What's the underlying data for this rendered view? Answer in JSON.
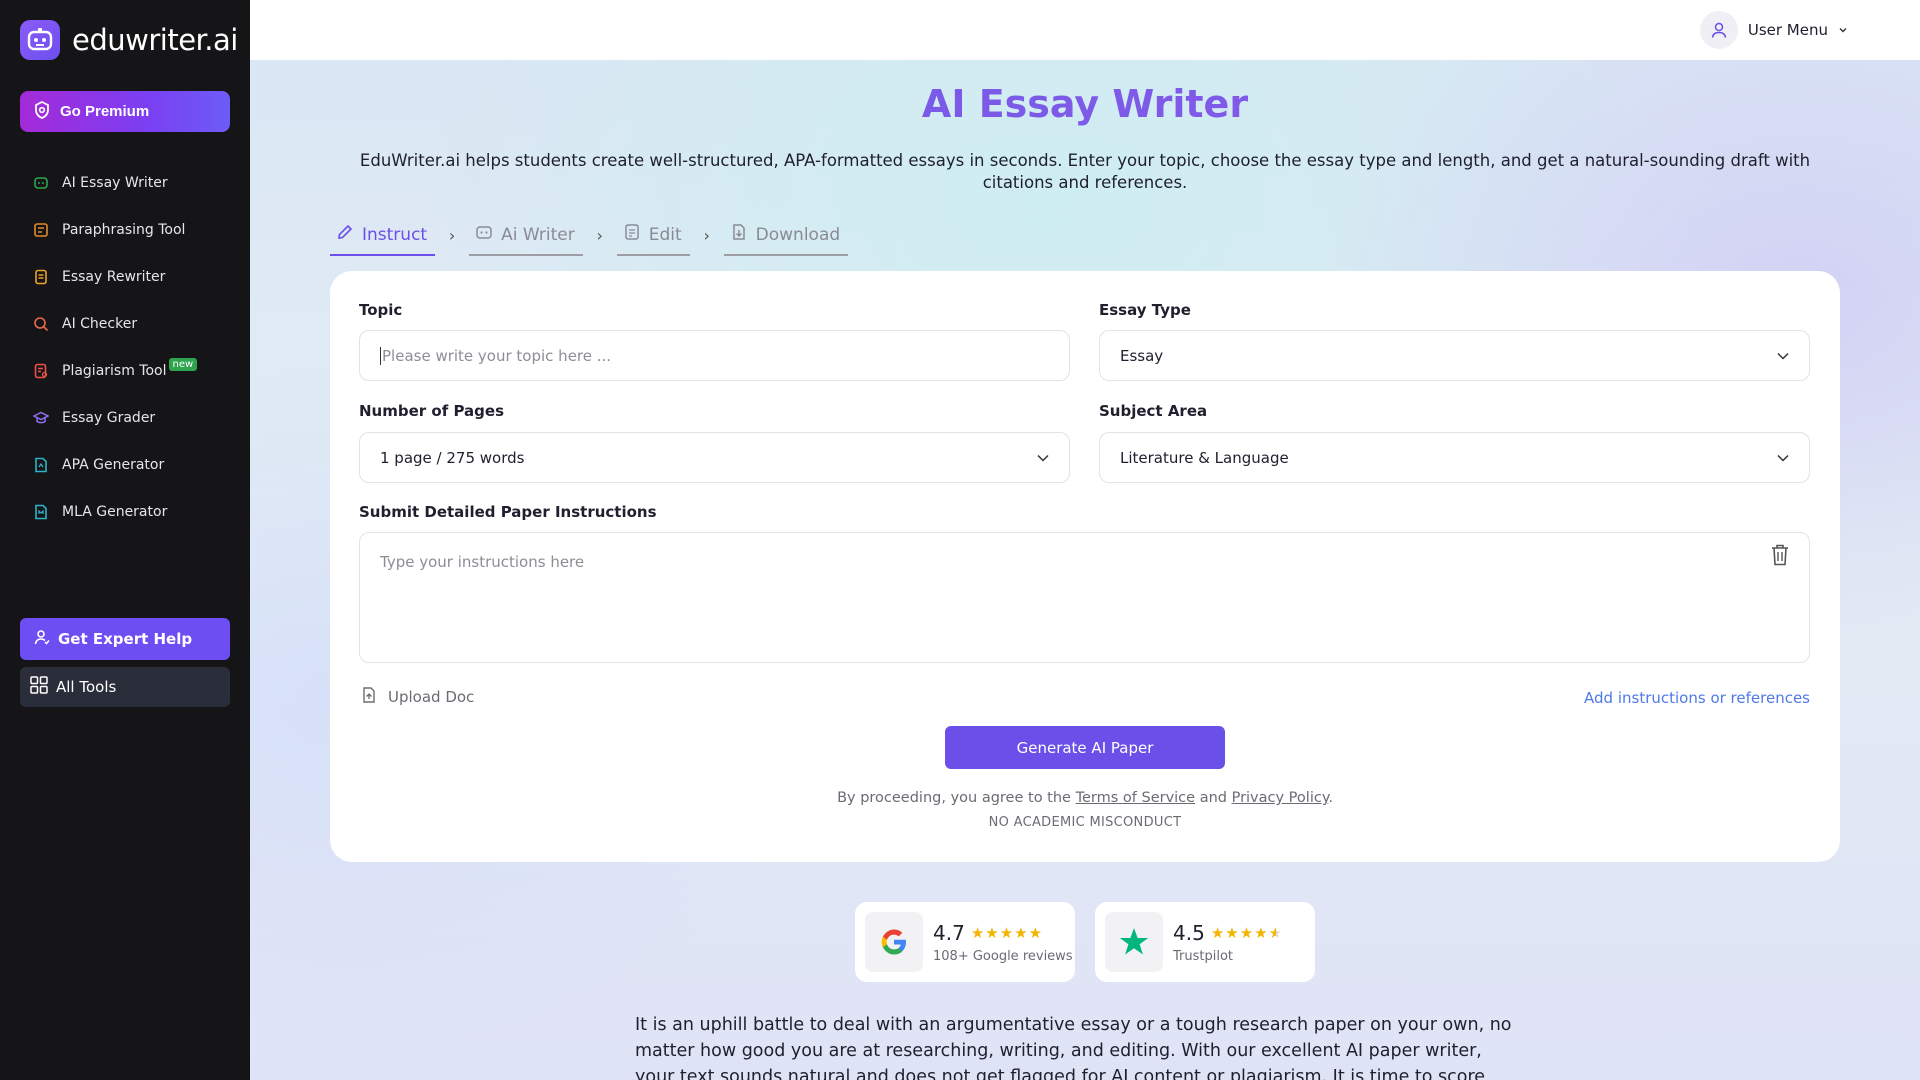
{
  "brand": {
    "name": "eduwriter.ai"
  },
  "sidebar": {
    "premium_label": "Go Premium",
    "items": [
      {
        "label": "AI Essay Writer",
        "icon": "robot-icon",
        "color": "#2ea44f"
      },
      {
        "label": "Paraphrasing Tool",
        "icon": "paraphrase-icon",
        "color": "#e48a2a"
      },
      {
        "label": "Essay Rewriter",
        "icon": "rewrite-icon",
        "color": "#e8a22a"
      },
      {
        "label": "AI Checker",
        "icon": "search-icon",
        "color": "#e86a4a"
      },
      {
        "label": "Plagiarism Tool",
        "icon": "plagiarism-icon",
        "color": "#e8524a",
        "badge": "new"
      },
      {
        "label": "Essay Grader",
        "icon": "grader-icon",
        "color": "#8e6ff0"
      },
      {
        "label": "APA Generator",
        "icon": "apa-icon",
        "color": "#2bb3c9"
      },
      {
        "label": "MLA Generator",
        "icon": "mla-icon",
        "color": "#2bb3c9"
      }
    ],
    "expert_label": "Get Expert Help",
    "all_tools_label": "All Tools"
  },
  "header": {
    "user_menu_label": "User Menu"
  },
  "page": {
    "title": "AI Essay Writer",
    "subtitle": "EduWriter.ai helps students create well-structured, APA-formatted essays in seconds. Enter your topic, choose the essay type and length, and get a natural-sounding draft with citations and references."
  },
  "steps": [
    {
      "label": "Instruct",
      "active": true
    },
    {
      "label": "Ai Writer",
      "active": false
    },
    {
      "label": "Edit",
      "active": false
    },
    {
      "label": "Download",
      "active": false
    }
  ],
  "form": {
    "topic_label": "Topic",
    "topic_placeholder": "Please write your topic here ...",
    "essay_type_label": "Essay Type",
    "essay_type_value": "Essay",
    "pages_label": "Number of Pages",
    "pages_value": "1 page / 275 words",
    "subject_label": "Subject Area",
    "subject_value": "Literature & Language",
    "instructions_label": "Submit Detailed Paper Instructions",
    "instructions_placeholder": "Type your instructions here",
    "upload_label": "Upload Doc",
    "add_ref_label": "Add instructions or references",
    "generate_label": "Generate AI Paper",
    "legal_prefix": "By proceeding, you agree to the",
    "terms_label": "Terms of Service",
    "legal_and": "and",
    "privacy_label": "Privacy Policy",
    "legal_suffix": ".",
    "no_misconduct": "NO ACADEMIC MISCONDUCT"
  },
  "reviews": [
    {
      "score": "4.7",
      "source": "108+ Google reviews",
      "icon": "google-icon",
      "rating": 4.7
    },
    {
      "score": "4.5",
      "source": "Trustpilot",
      "icon": "trustpilot-star-icon",
      "rating": 4.5
    }
  ],
  "body_text": "It is an uphill battle to deal with an argumentative essay or a tough research paper on your own, no matter how good you are at researching, writing, and editing. With our excellent AI paper writer, your text sounds natural and does not get flagged for AI content or plagiarism. It is time to score higher than your peers by working smart and",
  "colors": {
    "accent": "#6a4fe8",
    "sidebar_bg": "#151517",
    "link": "#4f79e6",
    "star": "#f5b400"
  }
}
